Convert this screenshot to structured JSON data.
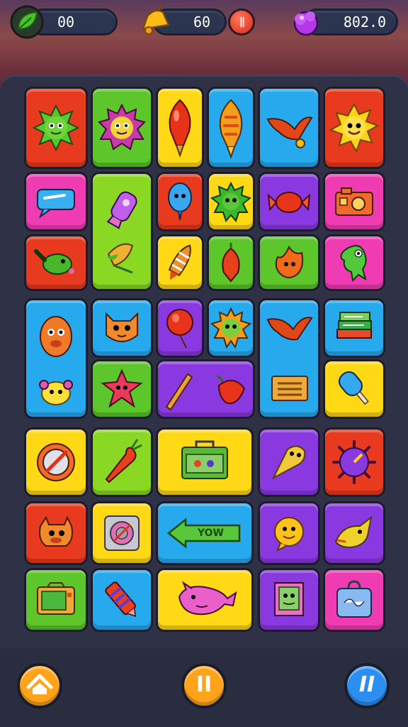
{
  "hud": {
    "leaf_counter": "00",
    "bell_counter": "60",
    "pause_mini_label": "||",
    "gem_counter": "802.0",
    "icons": [
      "leaf-icon",
      "bell-icon",
      "gem-icon"
    ],
    "colors": {
      "pill_bg": "#2b3550",
      "leaf": "#38b12a",
      "bell": "#ffb81a",
      "gem": "#b338e8"
    }
  },
  "board": {
    "tile_colors": {
      "red": "#e83a1e",
      "green": "#5cc62a",
      "lime": "#8ad824",
      "yellow": "#ffd816",
      "blue": "#27a9ee",
      "magenta": "#f03cb2",
      "purple": "#8a38e0"
    },
    "sign_text": "YOW",
    "tiles": [
      "sun-creature",
      "spiky-creature",
      "red-balloon",
      "striped-balloon",
      "orange-bird",
      "yellow-sun",
      "speech-bubble",
      "purple-rocket",
      "blue-balloon",
      "green-spiky",
      "red-candy",
      "camera",
      "green-lizard",
      "leaf-bird",
      "carrot-rocket",
      "red-pepper",
      "orange-flame",
      "green-ghost",
      "orange-bear",
      "orange-cat",
      "red-balloon-2",
      "sun-face",
      "orange-bird-2",
      "green-books",
      "yellow-blob",
      "pink-star",
      "orange-pencil",
      "red-tomato",
      "treasure-box",
      "blue-popsicle",
      "target-disc",
      "carrot",
      "toolbox",
      "ice-cream-cone",
      "purple-gear",
      "orange-bull",
      "speaker",
      "arrow-sign",
      "smiley",
      "yellow-bird",
      "green-tv",
      "crayon",
      "pink-whale",
      "picture-frame",
      "blue-bag"
    ]
  },
  "bottom_bar": {
    "home_label": "⌂",
    "pause_label": "II",
    "hint_label": "II",
    "icons": [
      "home-icon",
      "pause-icon",
      "hint-icon"
    ]
  }
}
